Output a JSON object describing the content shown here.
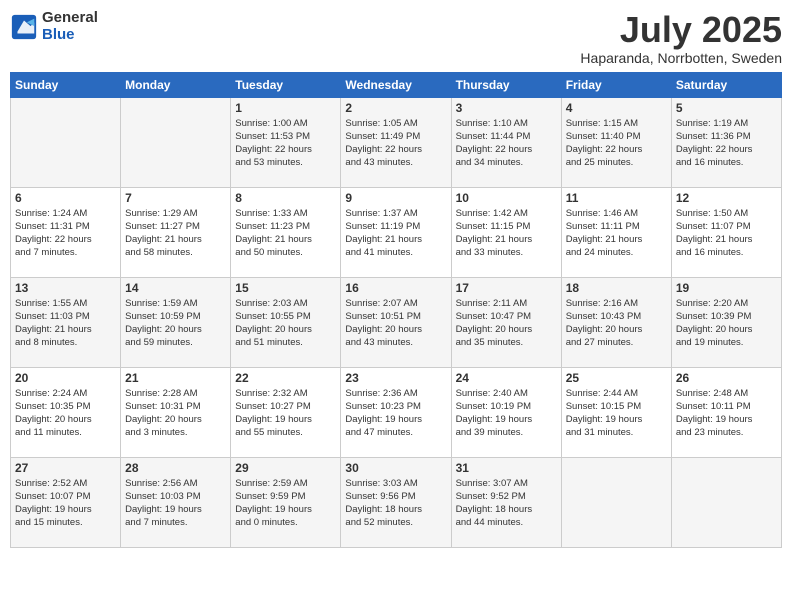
{
  "header": {
    "logo_general": "General",
    "logo_blue": "Blue",
    "month": "July 2025",
    "location": "Haparanda, Norrbotten, Sweden"
  },
  "days_of_week": [
    "Sunday",
    "Monday",
    "Tuesday",
    "Wednesday",
    "Thursday",
    "Friday",
    "Saturday"
  ],
  "weeks": [
    [
      {
        "day": "",
        "info": ""
      },
      {
        "day": "",
        "info": ""
      },
      {
        "day": "1",
        "info": "Sunrise: 1:00 AM\nSunset: 11:53 PM\nDaylight: 22 hours\nand 53 minutes."
      },
      {
        "day": "2",
        "info": "Sunrise: 1:05 AM\nSunset: 11:49 PM\nDaylight: 22 hours\nand 43 minutes."
      },
      {
        "day": "3",
        "info": "Sunrise: 1:10 AM\nSunset: 11:44 PM\nDaylight: 22 hours\nand 34 minutes."
      },
      {
        "day": "4",
        "info": "Sunrise: 1:15 AM\nSunset: 11:40 PM\nDaylight: 22 hours\nand 25 minutes."
      },
      {
        "day": "5",
        "info": "Sunrise: 1:19 AM\nSunset: 11:36 PM\nDaylight: 22 hours\nand 16 minutes."
      }
    ],
    [
      {
        "day": "6",
        "info": "Sunrise: 1:24 AM\nSunset: 11:31 PM\nDaylight: 22 hours\nand 7 minutes."
      },
      {
        "day": "7",
        "info": "Sunrise: 1:29 AM\nSunset: 11:27 PM\nDaylight: 21 hours\nand 58 minutes."
      },
      {
        "day": "8",
        "info": "Sunrise: 1:33 AM\nSunset: 11:23 PM\nDaylight: 21 hours\nand 50 minutes."
      },
      {
        "day": "9",
        "info": "Sunrise: 1:37 AM\nSunset: 11:19 PM\nDaylight: 21 hours\nand 41 minutes."
      },
      {
        "day": "10",
        "info": "Sunrise: 1:42 AM\nSunset: 11:15 PM\nDaylight: 21 hours\nand 33 minutes."
      },
      {
        "day": "11",
        "info": "Sunrise: 1:46 AM\nSunset: 11:11 PM\nDaylight: 21 hours\nand 24 minutes."
      },
      {
        "day": "12",
        "info": "Sunrise: 1:50 AM\nSunset: 11:07 PM\nDaylight: 21 hours\nand 16 minutes."
      }
    ],
    [
      {
        "day": "13",
        "info": "Sunrise: 1:55 AM\nSunset: 11:03 PM\nDaylight: 21 hours\nand 8 minutes."
      },
      {
        "day": "14",
        "info": "Sunrise: 1:59 AM\nSunset: 10:59 PM\nDaylight: 20 hours\nand 59 minutes."
      },
      {
        "day": "15",
        "info": "Sunrise: 2:03 AM\nSunset: 10:55 PM\nDaylight: 20 hours\nand 51 minutes."
      },
      {
        "day": "16",
        "info": "Sunrise: 2:07 AM\nSunset: 10:51 PM\nDaylight: 20 hours\nand 43 minutes."
      },
      {
        "day": "17",
        "info": "Sunrise: 2:11 AM\nSunset: 10:47 PM\nDaylight: 20 hours\nand 35 minutes."
      },
      {
        "day": "18",
        "info": "Sunrise: 2:16 AM\nSunset: 10:43 PM\nDaylight: 20 hours\nand 27 minutes."
      },
      {
        "day": "19",
        "info": "Sunrise: 2:20 AM\nSunset: 10:39 PM\nDaylight: 20 hours\nand 19 minutes."
      }
    ],
    [
      {
        "day": "20",
        "info": "Sunrise: 2:24 AM\nSunset: 10:35 PM\nDaylight: 20 hours\nand 11 minutes."
      },
      {
        "day": "21",
        "info": "Sunrise: 2:28 AM\nSunset: 10:31 PM\nDaylight: 20 hours\nand 3 minutes."
      },
      {
        "day": "22",
        "info": "Sunrise: 2:32 AM\nSunset: 10:27 PM\nDaylight: 19 hours\nand 55 minutes."
      },
      {
        "day": "23",
        "info": "Sunrise: 2:36 AM\nSunset: 10:23 PM\nDaylight: 19 hours\nand 47 minutes."
      },
      {
        "day": "24",
        "info": "Sunrise: 2:40 AM\nSunset: 10:19 PM\nDaylight: 19 hours\nand 39 minutes."
      },
      {
        "day": "25",
        "info": "Sunrise: 2:44 AM\nSunset: 10:15 PM\nDaylight: 19 hours\nand 31 minutes."
      },
      {
        "day": "26",
        "info": "Sunrise: 2:48 AM\nSunset: 10:11 PM\nDaylight: 19 hours\nand 23 minutes."
      }
    ],
    [
      {
        "day": "27",
        "info": "Sunrise: 2:52 AM\nSunset: 10:07 PM\nDaylight: 19 hours\nand 15 minutes."
      },
      {
        "day": "28",
        "info": "Sunrise: 2:56 AM\nSunset: 10:03 PM\nDaylight: 19 hours\nand 7 minutes."
      },
      {
        "day": "29",
        "info": "Sunrise: 2:59 AM\nSunset: 9:59 PM\nDaylight: 19 hours\nand 0 minutes."
      },
      {
        "day": "30",
        "info": "Sunrise: 3:03 AM\nSunset: 9:56 PM\nDaylight: 18 hours\nand 52 minutes."
      },
      {
        "day": "31",
        "info": "Sunrise: 3:07 AM\nSunset: 9:52 PM\nDaylight: 18 hours\nand 44 minutes."
      },
      {
        "day": "",
        "info": ""
      },
      {
        "day": "",
        "info": ""
      }
    ]
  ]
}
